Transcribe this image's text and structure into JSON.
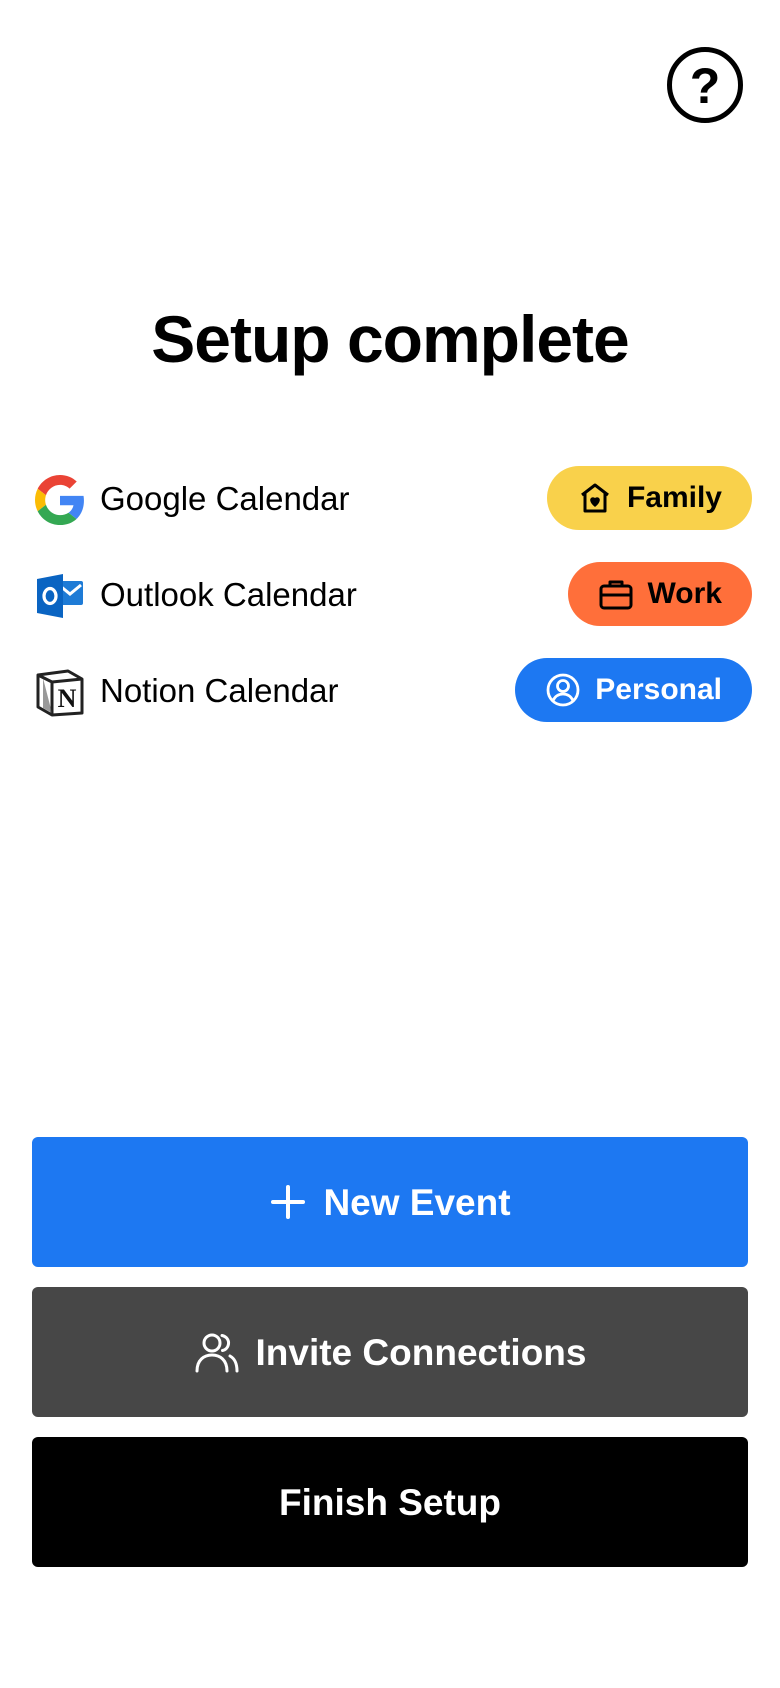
{
  "header": {
    "help_label": "?",
    "title": "Setup complete"
  },
  "calendars": [
    {
      "name": "Google Calendar",
      "icon": "google-icon",
      "tag": {
        "label": "Family",
        "icon": "home-heart-icon",
        "color": "#F9D14B",
        "text_color": "#000000"
      }
    },
    {
      "name": "Outlook Calendar",
      "icon": "outlook-icon",
      "tag": {
        "label": "Work",
        "icon": "briefcase-icon",
        "color": "#FF6F3A",
        "text_color": "#000000"
      }
    },
    {
      "name": "Notion Calendar",
      "icon": "notion-icon",
      "tag": {
        "label": "Personal",
        "icon": "user-circle-icon",
        "color": "#1D78F2",
        "text_color": "#FFFFFF"
      }
    }
  ],
  "actions": {
    "new_event": {
      "label": "New Event",
      "icon": "plus-icon",
      "color": "#1D78F2"
    },
    "invite": {
      "label": "Invite Connections",
      "icon": "users-icon",
      "color": "#474747"
    },
    "finish": {
      "label": "Finish Setup",
      "color": "#000000"
    }
  }
}
